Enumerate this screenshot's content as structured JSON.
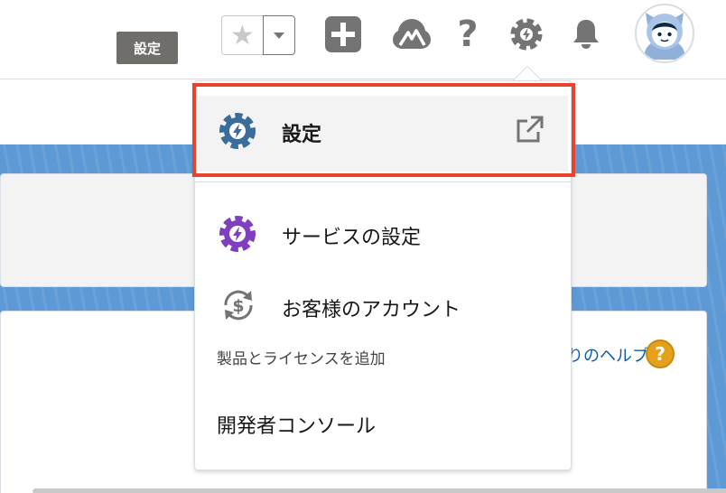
{
  "header": {
    "tooltip": "設定",
    "favorites": {
      "star_icon": "star-icon",
      "menu_icon": "chevron-down-icon"
    },
    "icons": [
      "add-icon",
      "trailhead-icon",
      "help-icon",
      "setup-gear-icon",
      "notification-bell-icon"
    ],
    "help_glyph": "?"
  },
  "setup_menu": {
    "items": [
      {
        "label": "設定",
        "icon": "setup-gear-icon",
        "external": true
      },
      {
        "label": "サービスの設定",
        "icon": "service-setup-gear-icon"
      },
      {
        "label": "お客様のアカウント",
        "icon": "customer-account-icon",
        "sublabel": "製品とライセンスを追加"
      },
      {
        "label": "開発者コンソール"
      }
    ]
  },
  "page": {
    "help_link": "りのヘルプ",
    "help_badge": "?"
  },
  "colors": {
    "highlight": "#e8442c",
    "setup_icon": "#3a6d9c",
    "service_icon": "#7f3fbf",
    "page_band": "#5d9ad5",
    "link": "#0b5cab",
    "help_badge": "#e5a11c"
  }
}
